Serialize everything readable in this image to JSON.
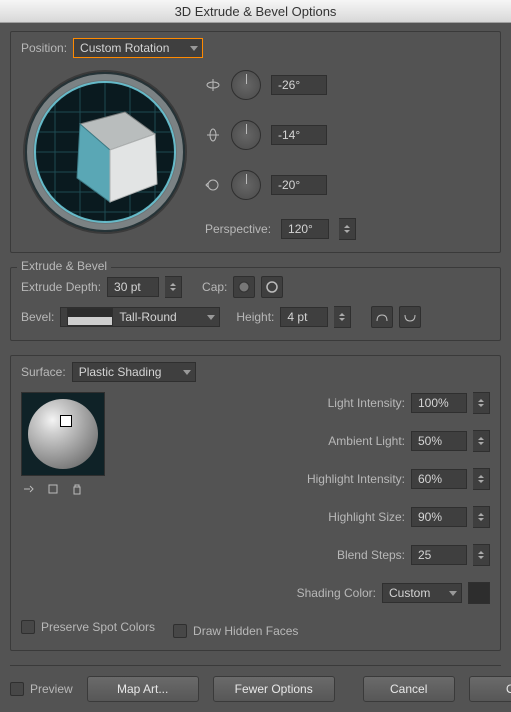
{
  "title": "3D Extrude & Bevel Options",
  "position": {
    "label": "Position:",
    "preset": "Custom Rotation",
    "axis_x": "-26°",
    "axis_y": "-14°",
    "axis_z": "-20°",
    "perspective_label": "Perspective:",
    "perspective": "120°"
  },
  "extrude": {
    "group_title": "Extrude & Bevel",
    "depth_label": "Extrude Depth:",
    "depth": "30 pt",
    "cap_label": "Cap:",
    "bevel_label": "Bevel:",
    "bevel_preset": "Tall-Round",
    "height_label": "Height:",
    "height": "4 pt"
  },
  "surface": {
    "label": "Surface:",
    "preset": "Plastic Shading",
    "light_intensity_label": "Light Intensity:",
    "light_intensity": "100%",
    "ambient_label": "Ambient Light:",
    "ambient": "50%",
    "highlight_intensity_label": "Highlight Intensity:",
    "highlight_intensity": "60%",
    "highlight_size_label": "Highlight Size:",
    "highlight_size": "90%",
    "blend_steps_label": "Blend Steps:",
    "blend_steps": "25",
    "shading_color_label": "Shading Color:",
    "shading_color": "Custom",
    "preserve_spot_label": "Preserve Spot Colors",
    "draw_hidden_label": "Draw Hidden Faces"
  },
  "footer": {
    "preview": "Preview",
    "map_art": "Map Art...",
    "fewer_options": "Fewer Options",
    "cancel": "Cancel",
    "ok": "OK"
  }
}
